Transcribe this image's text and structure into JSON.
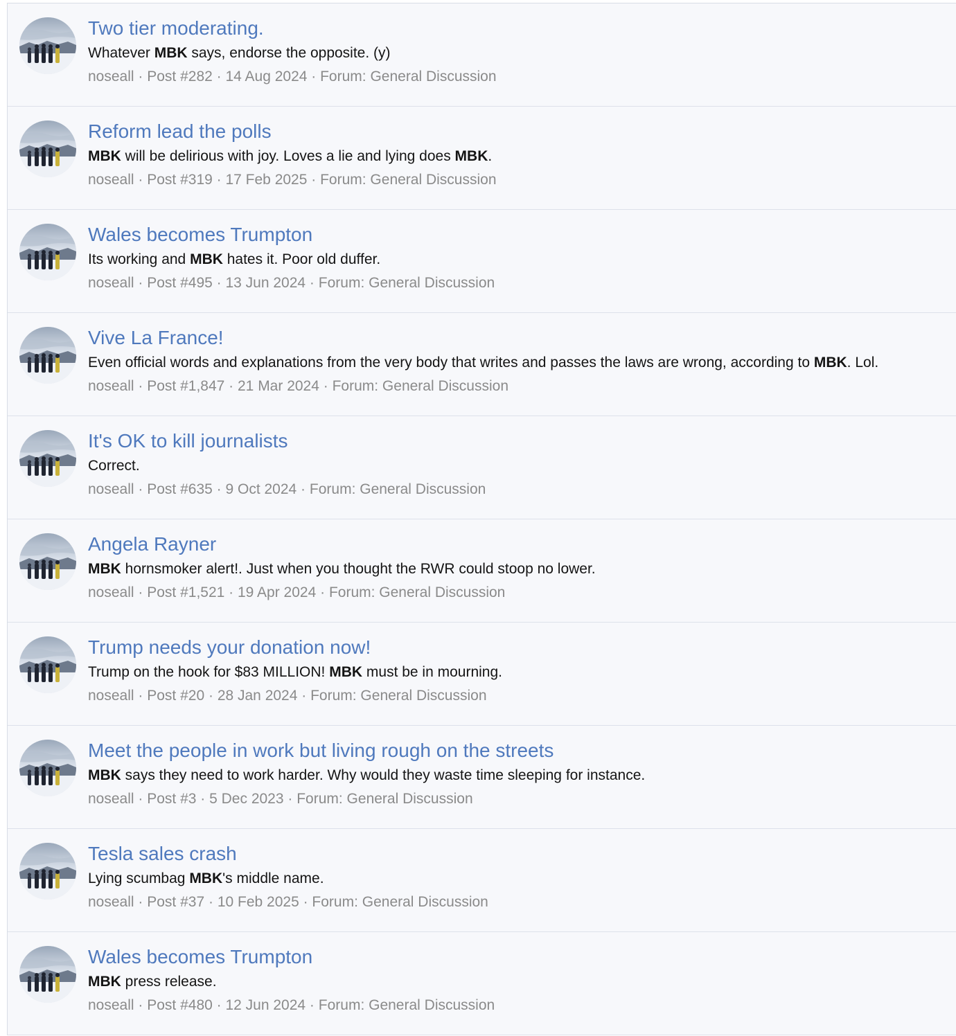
{
  "results": [
    {
      "title": "Two tier moderating.",
      "snippet": [
        {
          "text": "Whatever ",
          "bold": false
        },
        {
          "text": "MBK",
          "bold": true
        },
        {
          "text": " says, endorse the opposite. (y)",
          "bold": false
        }
      ],
      "author": "noseall",
      "post": "Post #282",
      "date": "14 Aug 2024",
      "forum": "Forum: General Discussion"
    },
    {
      "title": "Reform lead the polls",
      "snippet": [
        {
          "text": "MBK",
          "bold": true
        },
        {
          "text": " will be delirious with joy. Loves a lie and lying does ",
          "bold": false
        },
        {
          "text": "MBK",
          "bold": true
        },
        {
          "text": ".",
          "bold": false
        }
      ],
      "author": "noseall",
      "post": "Post #319",
      "date": "17 Feb 2025",
      "forum": "Forum: General Discussion"
    },
    {
      "title": "Wales becomes Trumpton",
      "snippet": [
        {
          "text": "Its working and ",
          "bold": false
        },
        {
          "text": "MBK",
          "bold": true
        },
        {
          "text": " hates it. Poor old duffer.",
          "bold": false
        }
      ],
      "author": "noseall",
      "post": "Post #495",
      "date": "13 Jun 2024",
      "forum": "Forum: General Discussion"
    },
    {
      "title": "Vive La France!",
      "snippet": [
        {
          "text": "Even official words and explanations from the very body that writes and passes the laws are wrong, according to ",
          "bold": false
        },
        {
          "text": "MBK",
          "bold": true
        },
        {
          "text": ". Lol.",
          "bold": false
        }
      ],
      "author": "noseall",
      "post": "Post #1,847",
      "date": "21 Mar 2024",
      "forum": "Forum: General Discussion"
    },
    {
      "title": "It's OK to kill journalists",
      "snippet": [
        {
          "text": "Correct.",
          "bold": false
        }
      ],
      "author": "noseall",
      "post": "Post #635",
      "date": "9 Oct 2024",
      "forum": "Forum: General Discussion"
    },
    {
      "title": "Angela Rayner",
      "snippet": [
        {
          "text": "MBK",
          "bold": true
        },
        {
          "text": " hornsmoker alert!. Just when you thought the RWR could stoop no lower.",
          "bold": false
        }
      ],
      "author": "noseall",
      "post": "Post #1,521",
      "date": "19 Apr 2024",
      "forum": "Forum: General Discussion"
    },
    {
      "title": "Trump needs your donation now!",
      "snippet": [
        {
          "text": "Trump on the hook for $83 MILLION! ",
          "bold": false
        },
        {
          "text": "MBK",
          "bold": true
        },
        {
          "text": " must be in mourning.",
          "bold": false
        }
      ],
      "author": "noseall",
      "post": "Post #20",
      "date": "28 Jan 2024",
      "forum": "Forum: General Discussion"
    },
    {
      "title": "Meet the people in work but living rough on the streets",
      "snippet": [
        {
          "text": "MBK",
          "bold": true
        },
        {
          "text": " says they need to work harder. Why would they waste time sleeping for instance.",
          "bold": false
        }
      ],
      "author": "noseall",
      "post": "Post #3",
      "date": "5 Dec 2023",
      "forum": "Forum: General Discussion"
    },
    {
      "title": "Tesla sales crash",
      "snippet": [
        {
          "text": "Lying scumbag ",
          "bold": false
        },
        {
          "text": "MBK",
          "bold": true
        },
        {
          "text": "'s middle name.",
          "bold": false
        }
      ],
      "author": "noseall",
      "post": "Post #37",
      "date": "10 Feb 2025",
      "forum": "Forum: General Discussion"
    },
    {
      "title": "Wales becomes Trumpton",
      "snippet": [
        {
          "text": "MBK",
          "bold": true
        },
        {
          "text": " press release.",
          "bold": false
        }
      ],
      "author": "noseall",
      "post": "Post #480",
      "date": "12 Jun 2024",
      "forum": "Forum: General Discussion"
    }
  ],
  "meta_separator": " · ",
  "colors": {
    "title": "#4f79bd",
    "snippet": "#141414",
    "meta": "#8a8a8a",
    "row_background": "#f7f8fb",
    "row_border": "#dde1ea"
  },
  "icons": {
    "avatar": "user-avatar-photo"
  }
}
